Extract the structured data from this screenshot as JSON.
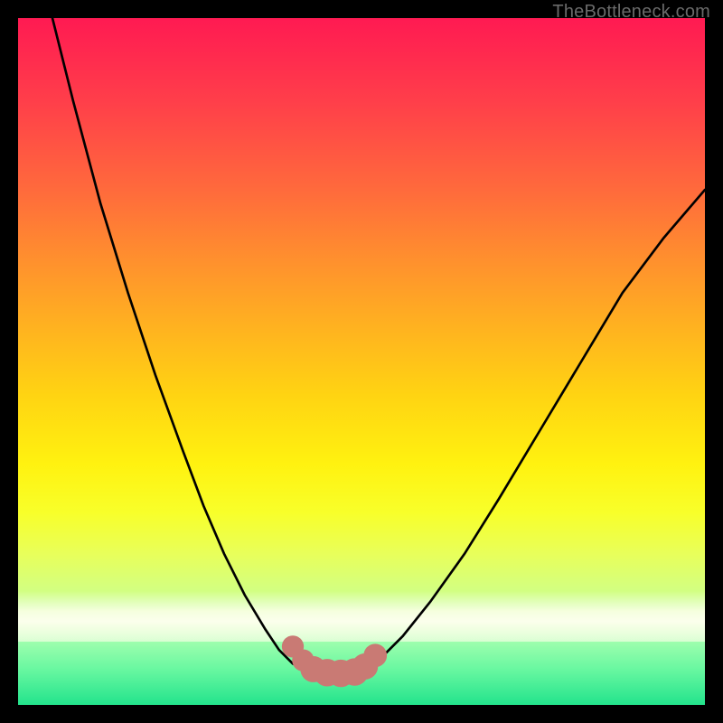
{
  "watermark": {
    "text": "TheBottleneck.com"
  },
  "colors": {
    "curve": "#000000",
    "marker": "#c97a74",
    "marker_stroke": "#c97a74"
  },
  "chart_data": {
    "type": "line",
    "title": "",
    "xlabel": "",
    "ylabel": "",
    "xlim": [
      0,
      100
    ],
    "ylim": [
      0,
      100
    ],
    "grid": false,
    "legend": false,
    "series": [
      {
        "name": "left-curve",
        "x": [
          5,
          8,
          12,
          16,
          20,
          24,
          27,
          30,
          33,
          36,
          38,
          40,
          42
        ],
        "y": [
          100,
          88,
          73,
          60,
          48,
          37,
          29,
          22,
          16,
          11,
          8,
          6,
          5
        ]
      },
      {
        "name": "right-curve",
        "x": [
          50,
          53,
          56,
          60,
          65,
          70,
          76,
          82,
          88,
          94,
          100
        ],
        "y": [
          5,
          7,
          10,
          15,
          22,
          30,
          40,
          50,
          60,
          68,
          75
        ]
      },
      {
        "name": "floor",
        "x": [
          42,
          44,
          46,
          48,
          50
        ],
        "y": [
          5,
          4.6,
          4.5,
          4.6,
          5
        ]
      }
    ],
    "markers": {
      "name": "highlight-points",
      "x": [
        40,
        41.5,
        43,
        45,
        47,
        49,
        50.5,
        52
      ],
      "y": [
        8.5,
        6.5,
        5.2,
        4.7,
        4.6,
        4.8,
        5.6,
        7.2
      ],
      "r": [
        1.6,
        1.6,
        1.9,
        2.0,
        2.0,
        2.0,
        1.9,
        1.7
      ]
    }
  }
}
